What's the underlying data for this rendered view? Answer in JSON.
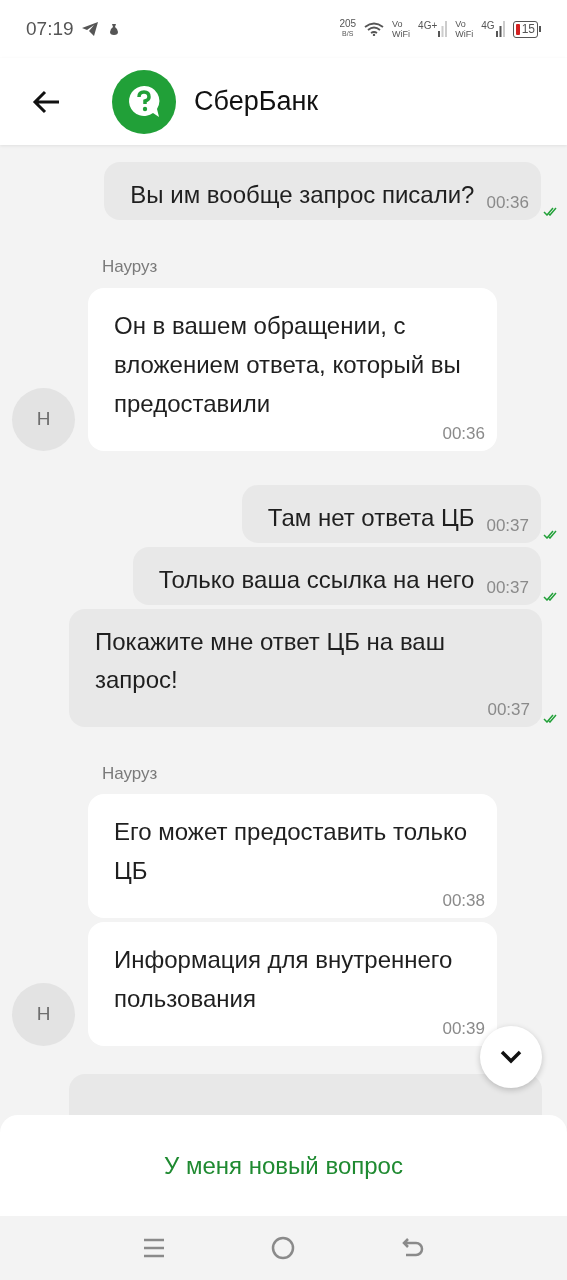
{
  "status_bar": {
    "time": "07:19",
    "speed_value": "205",
    "speed_unit": "B/S",
    "vowifi_1": [
      "Vo",
      "WiFi"
    ],
    "network_1": "4G+",
    "vowifi_2": [
      "Vo",
      "WiFi"
    ],
    "network_2": "4G",
    "battery": "15"
  },
  "header": {
    "title": "СберБанк"
  },
  "messages": [
    {
      "kind": "outgoing",
      "text": "Вы им вообще запрос писали?",
      "time": "00:36",
      "read": true
    },
    {
      "kind": "incoming",
      "sender": "Науруз",
      "avatar": "Н",
      "bubbles": [
        {
          "text": "Он в вашем обращении, с вложением ответа, который вы предоставили",
          "time": "00:36"
        }
      ]
    },
    {
      "kind": "outgoing",
      "text": "Там нет ответа ЦБ",
      "time": "00:37",
      "read": true
    },
    {
      "kind": "outgoing",
      "text": "Только ваша ссылка на него",
      "time": "00:37",
      "read": true
    },
    {
      "kind": "outgoing",
      "text": "Покажите мне ответ ЦБ на ваш запрос!",
      "time": "00:37",
      "read": true
    },
    {
      "kind": "incoming",
      "sender": "Науруз",
      "avatar": "Н",
      "bubbles": [
        {
          "text": "Его может предоставить только ЦБ",
          "time": "00:38"
        },
        {
          "text": "Информация для внутреннего пользования",
          "time": "00:39"
        }
      ]
    }
  ],
  "action": {
    "label": "У меня новый вопрос"
  }
}
